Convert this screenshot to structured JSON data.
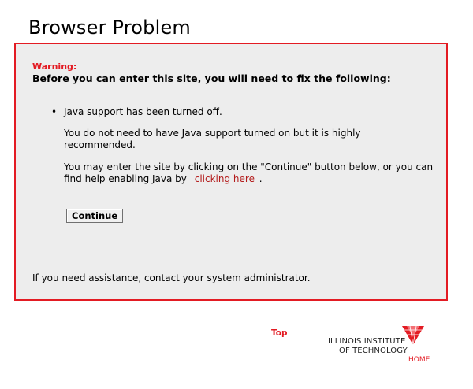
{
  "page": {
    "title": "Browser Problem"
  },
  "warning": {
    "label": "Warning:",
    "heading": "Before you can enter this site, you will need to fix the following:",
    "bullet": "•",
    "issue": "Java support has been turned off.",
    "note": "You do not need to have Java support turned on but it is highly recommended.",
    "help_text": "You may enter the site by clicking on the \"Continue\" button below, or you can find help enabling Java by",
    "help_link": "clicking here",
    "help_end": ".",
    "continue_label": "Continue",
    "assistance": "If you need assistance, contact your system administrator."
  },
  "footer": {
    "top_link": "Top",
    "logo_line1": "ILLINOIS INSTITUTE",
    "logo_line2": "OF TECHNOLOGY",
    "logo_home": "HOME",
    "logo_icon": "iit-logo-mark-icon"
  },
  "colors": {
    "accent": "#e31b23",
    "link": "#b31b1b",
    "panel": "#ededed"
  }
}
